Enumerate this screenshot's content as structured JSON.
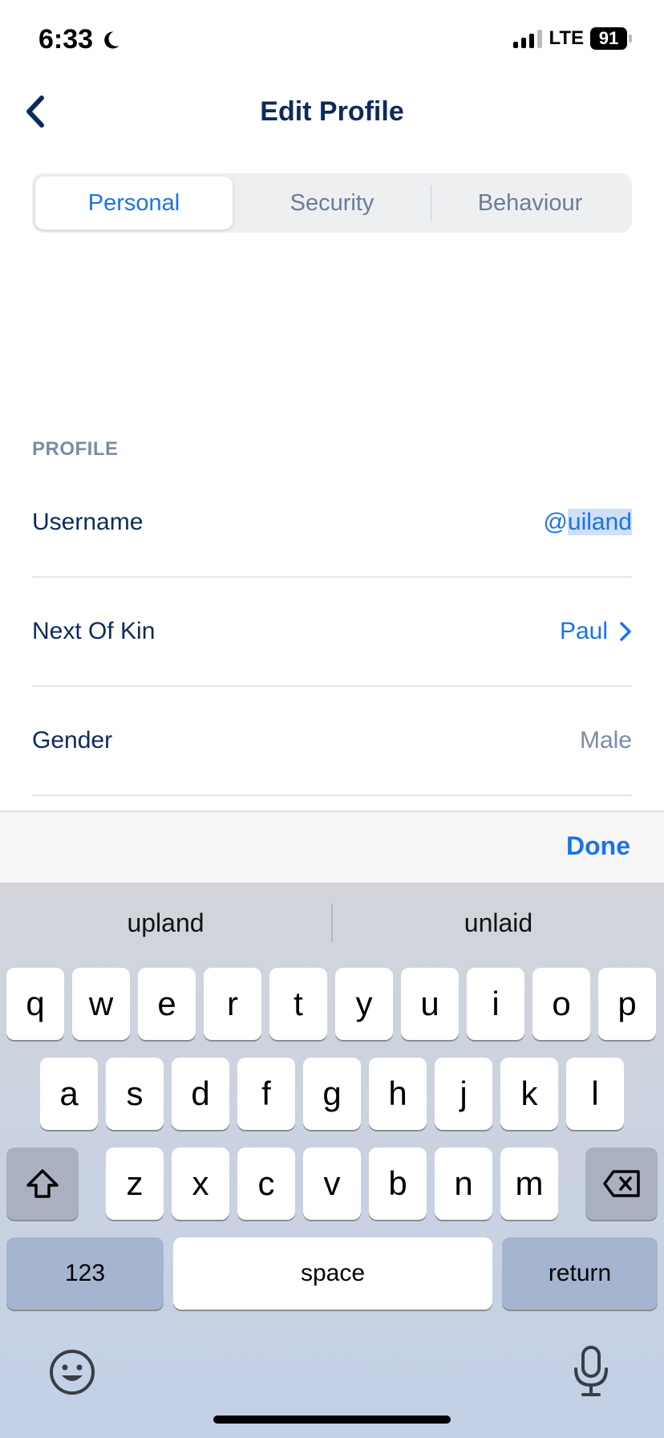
{
  "status_bar": {
    "time": "6:33",
    "network": "LTE",
    "battery": "91"
  },
  "header": {
    "title": "Edit Profile"
  },
  "tabs": [
    {
      "label": "Personal",
      "active": true
    },
    {
      "label": "Security",
      "active": false
    },
    {
      "label": "Behaviour",
      "active": false
    }
  ],
  "profile": {
    "section_title": "PROFILE",
    "username": {
      "label": "Username",
      "value_prefix": "@",
      "value_selected": "uiland"
    },
    "next_of_kin": {
      "label": "Next Of Kin",
      "value": "Paul"
    },
    "gender": {
      "label": "Gender",
      "value": "Male"
    }
  },
  "accessory": {
    "done_label": "Done"
  },
  "keyboard": {
    "suggestions": [
      "upland",
      "unlaid"
    ],
    "row1": [
      "q",
      "w",
      "e",
      "r",
      "t",
      "y",
      "u",
      "i",
      "o",
      "p"
    ],
    "row2": [
      "a",
      "s",
      "d",
      "f",
      "g",
      "h",
      "j",
      "k",
      "l"
    ],
    "row3": [
      "z",
      "x",
      "c",
      "v",
      "b",
      "n",
      "m"
    ],
    "numbers_label": "123",
    "space_label": "space",
    "return_label": "return"
  },
  "colors": {
    "accent": "#1a73e8",
    "title": "#0d2a5c",
    "muted": "#7b8ca8"
  },
  "icons": [
    "moon-icon",
    "signal-icon",
    "back-chevron-icon",
    "chevron-right-icon",
    "shift-icon",
    "delete-icon",
    "emoji-icon",
    "microphone-icon"
  ]
}
